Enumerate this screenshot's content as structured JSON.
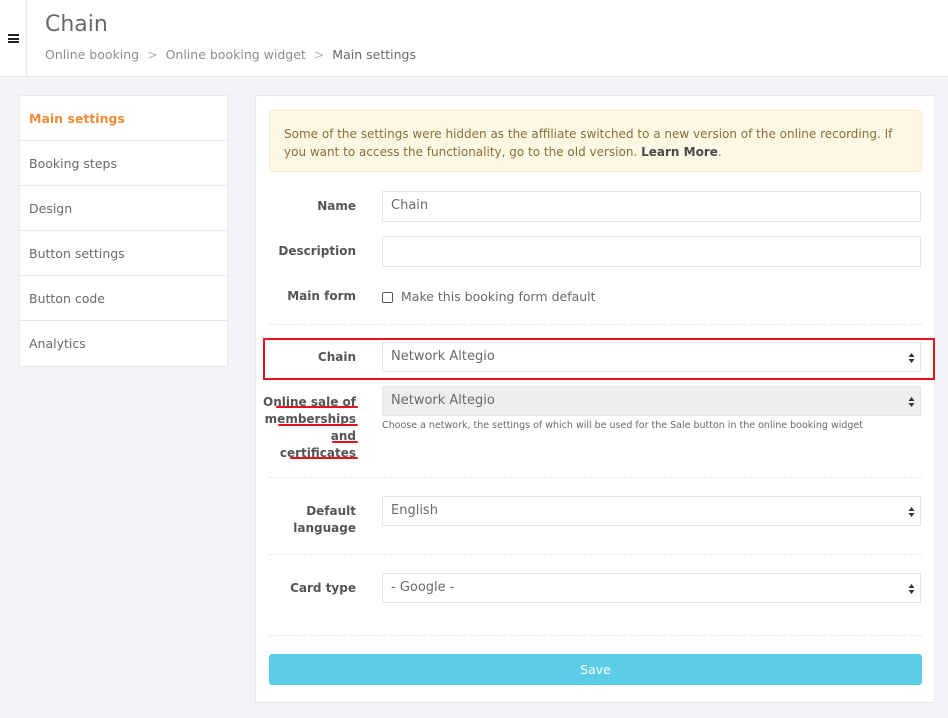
{
  "header": {
    "title": "Chain",
    "breadcrumb": [
      "Online booking",
      "Online booking widget",
      "Main settings"
    ]
  },
  "sidebar": {
    "items": [
      {
        "label": "Main settings",
        "active": true
      },
      {
        "label": "Booking steps"
      },
      {
        "label": "Design"
      },
      {
        "label": "Button settings"
      },
      {
        "label": "Button code"
      },
      {
        "label": "Analytics"
      }
    ]
  },
  "alert": {
    "text": "Some of the settings were hidden as the affiliate switched to a new version of the online recording. If you want to access the functionality, go to the old version.",
    "link": "Learn More",
    "end": "."
  },
  "form": {
    "name_label": "Name",
    "name_value": "Chain",
    "description_label": "Description",
    "description_value": "",
    "main_form_label": "Main form",
    "main_form_checkbox_label": "Make this booking form default",
    "chain_label": "Chain",
    "chain_value": "Network Altegio",
    "online_sale_label_1": "Online sale of",
    "online_sale_label_2": "memberships",
    "online_sale_label_3": "and",
    "online_sale_label_4": "certificates",
    "online_sale_value": "Network Altegio",
    "online_sale_help": "Choose a network, the settings of which will be used for the Sale button in the online booking widget",
    "default_language_label_1": "Default",
    "default_language_label_2": "language",
    "default_language_value": "English",
    "card_type_label": "Card type",
    "card_type_value": "- Google -",
    "save_label": "Save"
  },
  "colors": {
    "accent": "#f28c38",
    "save": "#5bcde6",
    "highlight": "#e3121d",
    "alert_bg": "#fcf8e3"
  }
}
